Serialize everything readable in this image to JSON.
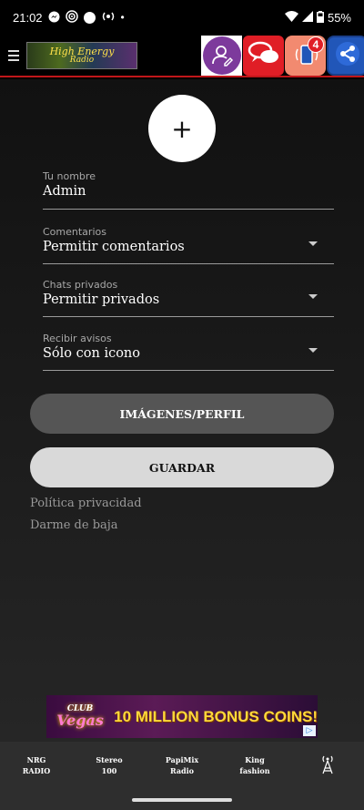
{
  "status_bar": {
    "time": "21:02",
    "battery": "55%"
  },
  "app_bar": {
    "logo_line1": "High Energy",
    "logo_line2": "Radio",
    "notification_count": "4"
  },
  "profile": {
    "add_photo_symbol": "+",
    "fields": [
      {
        "label": "Tu nombre",
        "value": "Admin"
      },
      {
        "label": "Comentarios",
        "value": "Permitir comentarios"
      },
      {
        "label": "Chats privados",
        "value": "Permitir privados"
      },
      {
        "label": "Recibir avisos",
        "value": "Sólo con icono"
      }
    ],
    "images_button": "IMÁGENES/PERFIL",
    "save_button": "GUARDAR",
    "privacy_link": "Política privacidad",
    "unsubscribe_link": "Darme de baja"
  },
  "ad": {
    "brand": "Vegas",
    "brand_prefix": "CLUB",
    "headline": "10 MILLION BONUS COINS!"
  },
  "bottom_nav": [
    {
      "line1": "NRG",
      "line2": "RADIO"
    },
    {
      "line1": "Stereo",
      "line2": "100"
    },
    {
      "line1": "PapiMix",
      "line2": "Radio"
    },
    {
      "line1": "King",
      "line2": "fashion"
    }
  ],
  "colors": {
    "accent_red": "#c0161a",
    "profile_purple": "#7d3a9c",
    "share_blue": "#2156b8"
  }
}
